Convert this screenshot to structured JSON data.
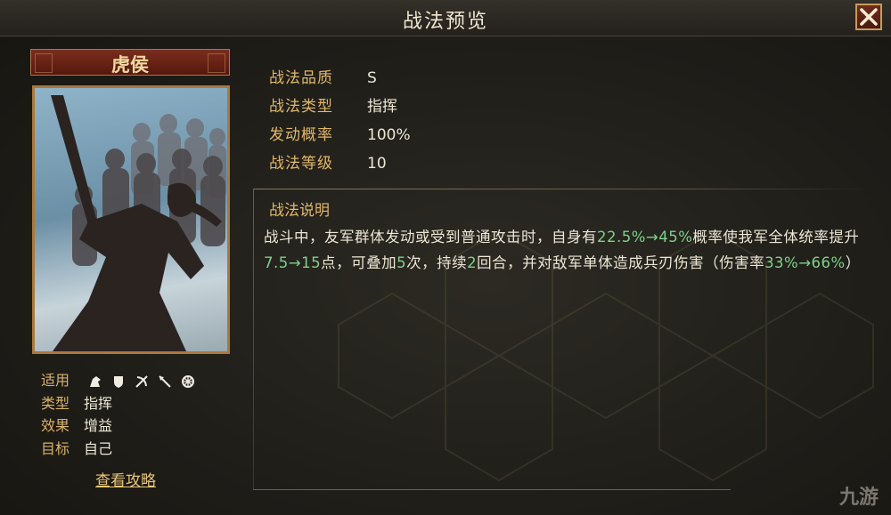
{
  "window": {
    "title": "战法预览"
  },
  "card": {
    "name": "虎侯",
    "info": [
      {
        "key": "适用",
        "value": ""
      },
      {
        "key": "类型",
        "value": "指挥"
      },
      {
        "key": "效果",
        "value": "增益"
      },
      {
        "key": "目标",
        "value": "自己"
      }
    ],
    "troop_icons": [
      "cavalry-icon",
      "shield-icon",
      "archer-icon",
      "spear-icon",
      "chariot-icon"
    ],
    "guide_link": "查看攻略"
  },
  "attributes": [
    {
      "key": "战法品质",
      "value": "S"
    },
    {
      "key": "战法类型",
      "value": "指挥"
    },
    {
      "key": "发动概率",
      "value": "100%"
    },
    {
      "key": "战法等级",
      "value": "10"
    }
  ],
  "description": {
    "title": "战法说明",
    "parts": [
      {
        "t": "战斗中，友军群体发动或受到普通攻击时，自身有",
        "hl": false
      },
      {
        "t": "22.5%→45%",
        "hl": true
      },
      {
        "t": "概率使我军全体统率提升",
        "hl": false
      },
      {
        "t": "7.5→15",
        "hl": true
      },
      {
        "t": "点，可叠加",
        "hl": false
      },
      {
        "t": "5",
        "hl": true
      },
      {
        "t": "次，持续",
        "hl": false
      },
      {
        "t": "2",
        "hl": true
      },
      {
        "t": "回合，并对敌军单体造成兵刃伤害（伤害率",
        "hl": false
      },
      {
        "t": "33%→66%",
        "hl": true
      },
      {
        "t": "）",
        "hl": false
      }
    ]
  },
  "watermark": "九游",
  "colors": {
    "highlight": "#7fd18c",
    "gold": "#e0b869",
    "close_bg": "#6d2b1c"
  }
}
